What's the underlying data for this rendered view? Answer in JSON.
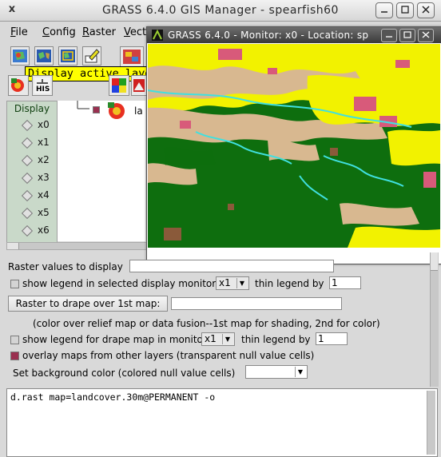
{
  "window": {
    "title": "GRASS 6.4.0 GIS Manager - spearfish60",
    "close_glyph": "x"
  },
  "menubar": [
    {
      "label": "File",
      "u": "F",
      "rest": "ile"
    },
    {
      "label": "Config",
      "u": "C",
      "rest": "onfig"
    },
    {
      "label": "Raster",
      "u": "R",
      "rest": "aster"
    },
    {
      "label": "Vecto",
      "u": "V",
      "rest": "ecto"
    }
  ],
  "tooltip": "Display active layers in current region",
  "toolbar2": {
    "his_label": "HIS"
  },
  "display_panel": {
    "header": "Display",
    "monitors": [
      "x0",
      "x1",
      "x2",
      "x3",
      "x4",
      "x5",
      "x6"
    ]
  },
  "layer_tree": {
    "layer_label": "la"
  },
  "monitor": {
    "title": "GRASS 6.4.0 - Monitor: x0 - Location: sp",
    "colors": {
      "forest": "#0e6e0e",
      "yellow": "#f2f200",
      "tan": "#d8b890",
      "pink": "#d85a7a",
      "cyan": "#40e0e0",
      "brown": "#8a5a3a"
    }
  },
  "options": {
    "raster_values_label": "Raster values to display",
    "raster_values_value": "",
    "show_legend_label": "show legend in selected display monitor",
    "legend_monitor": "x1",
    "thin_legend_label": "thin legend by",
    "thin_legend_value": "1",
    "drape_button": "Raster to drape over 1st map:",
    "drape_value": "",
    "drape_note": "(color over relief map or data fusion--1st map for shading, 2nd for color)",
    "show_legend_drape_label": "show legend for drape map in monitor",
    "drape_monitor": "x1",
    "thin_legend_drape_label": "thin legend by",
    "thin_legend_drape_value": "1",
    "overlay_label": "overlay maps from other layers (transparent null value cells)",
    "overlay_checked": true,
    "bg_color_label": "Set background color (colored null value cells)",
    "bg_color_value": ""
  },
  "command": "d.rast map=landcover.30m@PERMANENT -o"
}
